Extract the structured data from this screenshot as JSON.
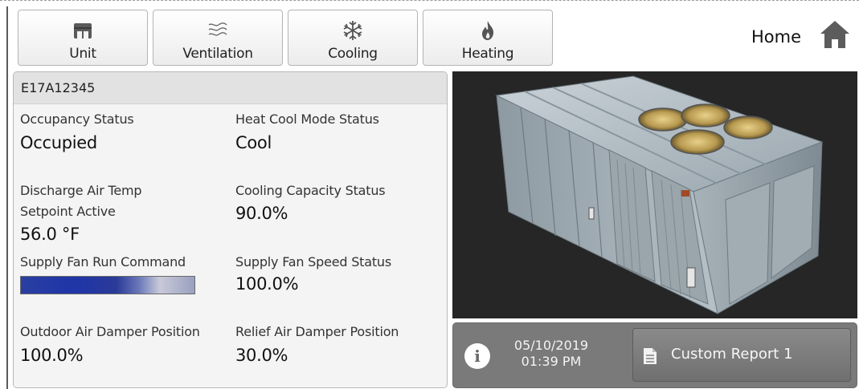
{
  "nav": {
    "unit_label": "Unit",
    "ventilation_label": "Ventilation",
    "cooling_label": "Cooling",
    "heating_label": "Heating",
    "home_label": "Home",
    "icons": [
      "unit-icon",
      "ventilation-icon",
      "snowflake-icon",
      "flame-icon",
      "home-icon"
    ]
  },
  "panel": {
    "unit_id": "E17A12345",
    "occupancy_label": "Occupancy Status",
    "occupancy_value": "Occupied",
    "heat_cool_label": "Heat Cool Mode Status",
    "heat_cool_value": "Cool",
    "discharge_label_1": "Discharge Air Temp",
    "discharge_label_2": "Setpoint Active",
    "discharge_value": "56.0 °F",
    "cooling_capacity_label": "Cooling Capacity Status",
    "cooling_capacity_value": "90.0%",
    "supply_fan_run_label": "Supply Fan Run Command",
    "supply_fan_speed_label": "Supply Fan Speed Status",
    "supply_fan_speed_value": "100.0%",
    "outdoor_damper_label": "Outdoor Air Damper Position",
    "outdoor_damper_value": "100.0%",
    "relief_damper_label": "Relief Air Damper Position",
    "relief_damper_value": "30.0%"
  },
  "footer": {
    "date": "05/10/2019",
    "time": "01:39 PM",
    "report_label": "Custom Report 1"
  },
  "colors": {
    "panel_bg": "#f4f4f4",
    "photo_bg": "#262626",
    "footer_bg": "#7a7a7a",
    "fan_bar": "#1f35a8"
  }
}
